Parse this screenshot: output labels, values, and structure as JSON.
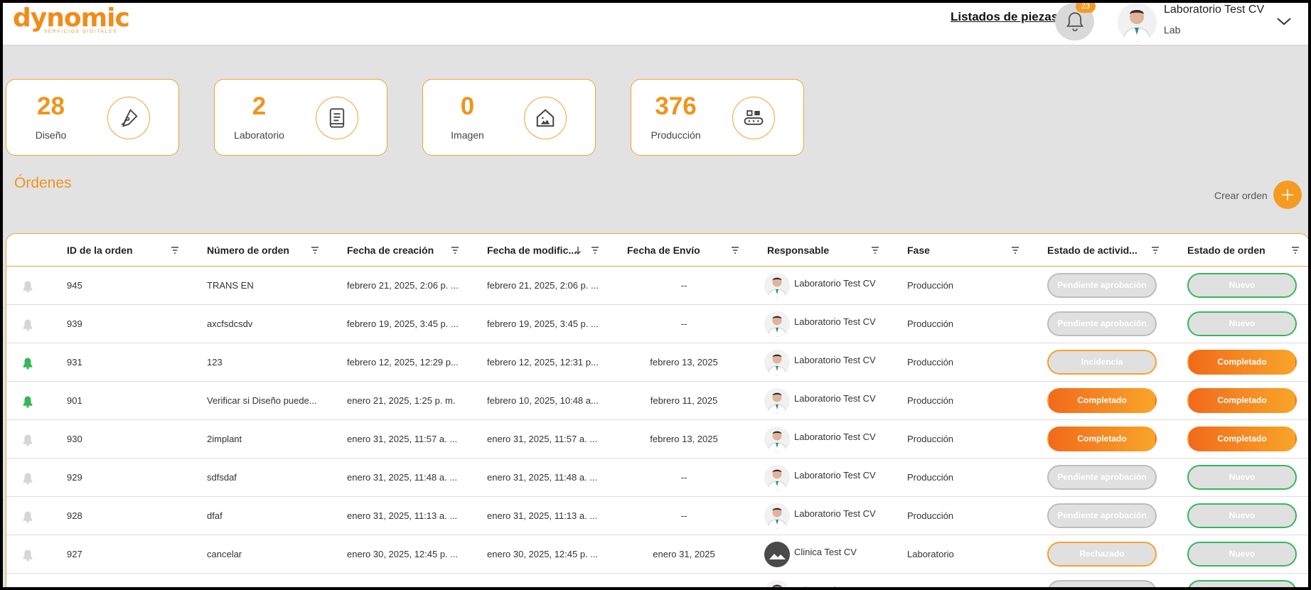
{
  "header": {
    "logo_text": "dynomic",
    "logo_subtitle": "SERVICIOS DIGITALES",
    "parts_link": "Listados de piezas",
    "notifications_count": "23",
    "user_name": "Laboratorio Test CV",
    "user_role": "Lab"
  },
  "stats": [
    {
      "value": "28",
      "label": "Diseño",
      "icon": "pen-icon"
    },
    {
      "value": "2",
      "label": "Laboratorio",
      "icon": "document-icon"
    },
    {
      "value": "0",
      "label": "Imagen",
      "icon": "house-image-icon"
    },
    {
      "value": "376",
      "label": "Producción",
      "icon": "conveyor-icon"
    }
  ],
  "orders": {
    "title": "Órdenes",
    "create_label": "Crear orden",
    "columns": [
      "ID de la orden",
      "Número de orden",
      "Fecha de creación",
      "Fecha de modific...",
      "Fecha de Envío",
      "Responsable",
      "Fase",
      "Estado de activid...",
      "Estado de orden"
    ],
    "rows": [
      {
        "bell": "gray",
        "id": "945",
        "number": "TRANS EN",
        "created": "febrero 21, 2025, 2:06 p. ...",
        "modified": "febrero 21, 2025, 2:06 p. ...",
        "shipped": "--",
        "responsible": "Laboratorio Test CV",
        "avatar": "doctor",
        "phase": "Producción",
        "activity": "Pendiente aprobación",
        "activity_style": "gray",
        "order_status": "Nuevo",
        "order_style": "green"
      },
      {
        "bell": "gray",
        "id": "939",
        "number": "axcfsdcsdv",
        "created": "febrero 19, 2025, 3:45 p. ...",
        "modified": "febrero 19, 2025, 3:45 p. ...",
        "shipped": "--",
        "responsible": "Laboratorio Test CV",
        "avatar": "doctor",
        "phase": "Producción",
        "activity": "Pendiente aprobación",
        "activity_style": "gray",
        "order_status": "Nuevo",
        "order_style": "green"
      },
      {
        "bell": "green",
        "id": "931",
        "number": "123",
        "created": "febrero 12, 2025, 12:29 p...",
        "modified": "febrero 12, 2025, 12:31 p...",
        "shipped": "febrero 13, 2025",
        "responsible": "Laboratorio Test CV",
        "avatar": "doctor",
        "phase": "Producción",
        "activity": "Incidencia",
        "activity_style": "gray-orange",
        "order_status": "Completado",
        "order_style": "orange"
      },
      {
        "bell": "green",
        "id": "901",
        "number": "Verificar si Diseño puede...",
        "created": "enero 21, 2025, 1:25 p. m.",
        "modified": "febrero 10, 2025, 10:48 a...",
        "shipped": "febrero 11, 2025",
        "responsible": "Laboratorio Test CV",
        "avatar": "doctor",
        "phase": "Producción",
        "activity": "Completado",
        "activity_style": "orange",
        "order_status": "Completado",
        "order_style": "orange"
      },
      {
        "bell": "gray",
        "id": "930",
        "number": "2implant",
        "created": "enero 31, 2025, 11:57 a. ...",
        "modified": "enero 31, 2025, 11:57 a. ...",
        "shipped": "febrero 13, 2025",
        "responsible": "Laboratorio Test CV",
        "avatar": "doctor",
        "phase": "Producción",
        "activity": "Completado",
        "activity_style": "orange",
        "order_status": "Completado",
        "order_style": "orange"
      },
      {
        "bell": "gray",
        "id": "929",
        "number": "sdfsdaf",
        "created": "enero 31, 2025, 11:48 a. ...",
        "modified": "enero 31, 2025, 11:48 a. ...",
        "shipped": "--",
        "responsible": "Laboratorio Test CV",
        "avatar": "doctor",
        "phase": "Producción",
        "activity": "Pendiente aprobación",
        "activity_style": "gray",
        "order_status": "Nuevo",
        "order_style": "green"
      },
      {
        "bell": "gray",
        "id": "928",
        "number": "dfaf",
        "created": "enero 31, 2025, 11:13 a. ...",
        "modified": "enero 31, 2025, 11:13 a. ...",
        "shipped": "--",
        "responsible": "Laboratorio Test CV",
        "avatar": "doctor",
        "phase": "Producción",
        "activity": "Pendiente aprobación",
        "activity_style": "gray",
        "order_status": "Nuevo",
        "order_style": "green"
      },
      {
        "bell": "gray",
        "id": "927",
        "number": "cancelar",
        "created": "enero 30, 2025, 12:45 p. ...",
        "modified": "enero 30, 2025, 12:45 p. ...",
        "shipped": "enero 31, 2025",
        "responsible": "Clinica Test CV",
        "avatar": "placeholder",
        "phase": "Laboratorio",
        "activity": "Rechazado",
        "activity_style": "gray-orange",
        "order_status": "Nuevo",
        "order_style": "green"
      },
      {
        "bell": "gray",
        "id": "",
        "number": "",
        "created": "",
        "modified": "",
        "shipped": "",
        "responsible": "Laboratorio Test CV",
        "avatar": "doctor",
        "phase": "",
        "activity": "",
        "activity_style": "gray",
        "order_status": "",
        "order_style": "green"
      }
    ]
  },
  "colors": {
    "accent": "#f59b22",
    "green": "#34b85a",
    "gray_bell": "#d6d6d6"
  }
}
